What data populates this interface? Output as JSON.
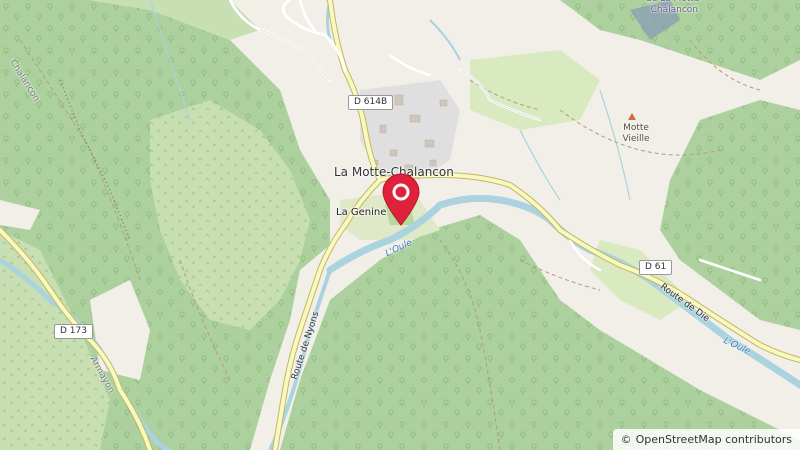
{
  "map": {
    "place_labels": {
      "town": "La Motte-Chalancon",
      "la_genine": "La Genine",
      "motte_vieille": "Motte\nVieille",
      "chalancon": "Chalancon",
      "armayon": "Armayon",
      "top_right": "de La Motte-\nChalancon"
    },
    "road_labels": {
      "d614b": "D 614B",
      "d61": "D 61",
      "d173": "D 173",
      "route_nyons": "Route de Nyons",
      "route_die": "Route de Die"
    },
    "water_labels": {
      "oule_1": "L'Oule",
      "oule_2": "L'Oule"
    },
    "marker": {
      "name": "location-pin",
      "color": "#e0213b"
    },
    "colors": {
      "background": "#f2efe9",
      "forest": "#add19e",
      "forest_light": "#c8dfb3",
      "scrub": "#d9e9c0",
      "river": "#aad3df",
      "road_major": "#f7fabf",
      "road_casing": "#c5b566",
      "track": "#a58460"
    }
  },
  "attribution": {
    "symbol": "©",
    "text": "OpenStreetMap contributors"
  }
}
